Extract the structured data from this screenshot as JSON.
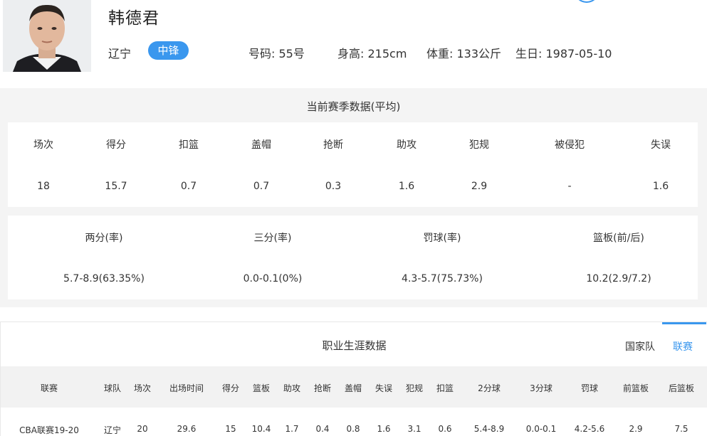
{
  "player": {
    "name": "韩德君",
    "team": "辽宁",
    "position": "中锋",
    "number": "号码: 55号",
    "height": "身高: 215cm",
    "weight": "体重: 133公斤",
    "birthday": "生日: 1987-05-10"
  },
  "season": {
    "title": "当前赛季数据(平均)",
    "basic_headers": [
      "场次",
      "得分",
      "扣篮",
      "盖帽",
      "抢断",
      "助攻",
      "犯规",
      "被侵犯",
      "失误"
    ],
    "basic_values": [
      "18",
      "15.7",
      "0.7",
      "0.7",
      "0.3",
      "1.6",
      "2.9",
      "-",
      "1.6"
    ],
    "shoot_headers": [
      "两分(率)",
      "三分(率)",
      "罚球(率)",
      "篮板(前/后)"
    ],
    "shoot_values": [
      "5.7-8.9(63.35%)",
      "0.0-0.1(0%)",
      "4.3-5.7(75.73%)",
      "10.2(2.9/7.2)"
    ]
  },
  "career": {
    "title": "职业生涯数据",
    "tabs": [
      "国家队",
      "联赛"
    ],
    "active_tab": "联赛",
    "headers": [
      "联赛",
      "球队",
      "场次",
      "出场时间",
      "得分",
      "篮板",
      "助攻",
      "抢断",
      "盖帽",
      "失误",
      "犯规",
      "扣篮",
      "2分球",
      "3分球",
      "罚球",
      "前篮板",
      "后篮板"
    ],
    "rows": [
      [
        "CBA联赛19-20",
        "辽宁",
        "20",
        "29.6",
        "15",
        "10.4",
        "1.7",
        "0.4",
        "0.8",
        "1.6",
        "3.1",
        "0.6",
        "5.4-8.9",
        "0.0-0.1",
        "4.2-5.6",
        "2.9",
        "7.5"
      ]
    ]
  },
  "colors": {
    "accent": "#3a97ee",
    "section_bg": "#f4f4f4",
    "table_head_bg": "#f2f2f2"
  }
}
